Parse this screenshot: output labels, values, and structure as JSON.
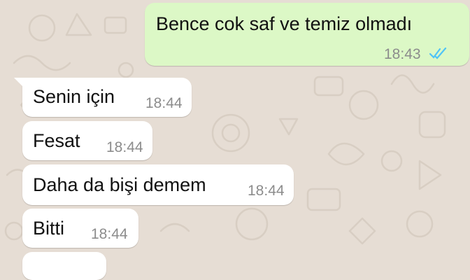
{
  "conversation": {
    "messages": [
      {
        "direction": "outgoing",
        "text": "Bence cok saf ve temiz olmadı",
        "time": "18:43",
        "status": "read"
      },
      {
        "direction": "incoming",
        "text": "Senin için",
        "time": "18:44"
      },
      {
        "direction": "incoming",
        "text": "Fesat",
        "time": "18:44"
      },
      {
        "direction": "incoming",
        "text": "Daha da bişi demem",
        "time": "18:44"
      },
      {
        "direction": "incoming",
        "text": "Bitti",
        "time": "18:44"
      }
    ]
  },
  "colors": {
    "wallpaper": "#e6ddd4",
    "outgoing_bubble": "#dcf8c6",
    "incoming_bubble": "#ffffff",
    "read_tick": "#4fc3f7",
    "timestamp": "#8c8c8c"
  },
  "icons": {
    "read_receipt": "double-check-icon"
  }
}
